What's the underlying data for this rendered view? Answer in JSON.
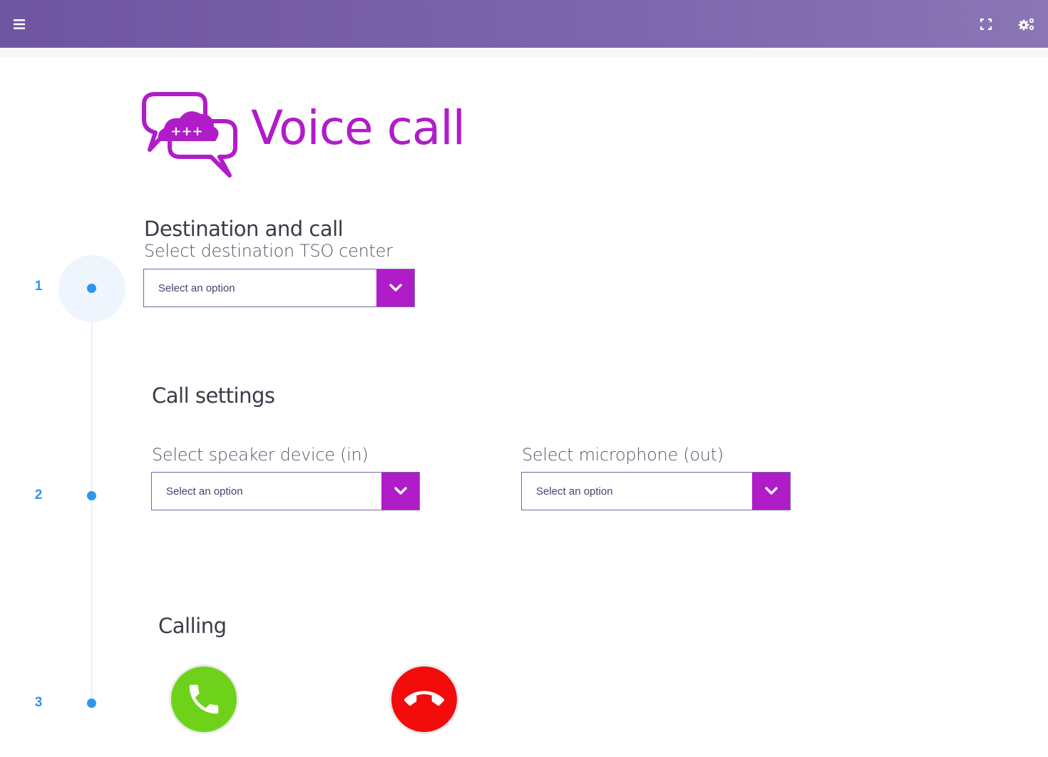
{
  "topbar": {
    "menu_icon": "hamburger-menu-icon",
    "fullscreen_icon": "fullscreen-icon",
    "settings_icon": "gears-icon"
  },
  "logo": {
    "title": "Voice call",
    "badge_text": "+++",
    "color": "#b01cc8"
  },
  "steps": [
    {
      "number": "1"
    },
    {
      "number": "2"
    },
    {
      "number": "3"
    }
  ],
  "destination": {
    "title": "Destination and call",
    "subtitle": "Select destination TSO center",
    "select_value": "Select an option"
  },
  "call_settings": {
    "title": "Call settings",
    "speaker_label": "Select speaker device (in)",
    "speaker_value": "Select an option",
    "microphone_label": "Select microphone (out)",
    "microphone_value": "Select an option"
  },
  "calling": {
    "title": "Calling",
    "accept_icon": "phone-accept-icon",
    "hangup_icon": "phone-hangup-icon"
  },
  "colors": {
    "accent": "#b01cc8",
    "step_blue": "#2f96f0",
    "call_green": "#6fd21a",
    "call_red": "#f20c0c"
  }
}
